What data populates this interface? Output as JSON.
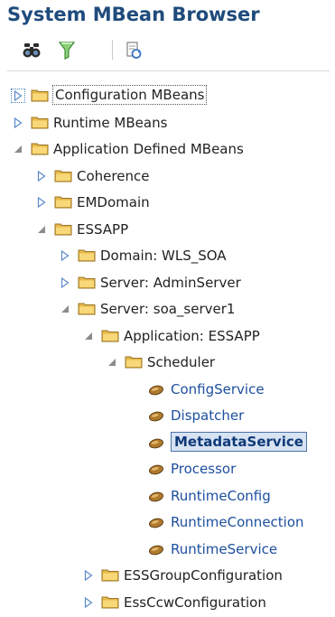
{
  "title": "System MBean Browser",
  "toolbar": {
    "find_icon": "binoculars-icon",
    "filter_icon": "filter-icon",
    "refresh_icon": "refresh-icon"
  },
  "tree": [
    {
      "label": "Configuration MBeans",
      "expanded": false,
      "type": "folder",
      "focused": true
    },
    {
      "label": "Runtime MBeans",
      "expanded": false,
      "type": "folder"
    },
    {
      "label": "Application Defined MBeans",
      "expanded": true,
      "type": "folder"
    },
    {
      "label": "Coherence",
      "expanded": false,
      "type": "folder"
    },
    {
      "label": "EMDomain",
      "expanded": false,
      "type": "folder"
    },
    {
      "label": "ESSAPP",
      "expanded": true,
      "type": "folder"
    },
    {
      "label": "Domain: WLS_SOA",
      "expanded": false,
      "type": "folder"
    },
    {
      "label": "Server: AdminServer",
      "expanded": false,
      "type": "folder"
    },
    {
      "label": "Server: soa_server1",
      "expanded": true,
      "type": "folder"
    },
    {
      "label": "Application: ESSAPP",
      "expanded": true,
      "type": "folder"
    },
    {
      "label": "Scheduler",
      "expanded": true,
      "type": "folder"
    },
    {
      "label": "ConfigService",
      "type": "mbean"
    },
    {
      "label": "Dispatcher",
      "type": "mbean"
    },
    {
      "label": "MetadataService",
      "type": "mbean",
      "selected": true
    },
    {
      "label": "Processor",
      "type": "mbean"
    },
    {
      "label": "RuntimeConfig",
      "type": "mbean"
    },
    {
      "label": "RuntimeConnection",
      "type": "mbean"
    },
    {
      "label": "RuntimeService",
      "type": "mbean"
    },
    {
      "label": "ESSGroupConfiguration",
      "expanded": false,
      "type": "folder"
    },
    {
      "label": "EssCcwConfiguration",
      "expanded": false,
      "type": "folder"
    }
  ],
  "colors": {
    "title": "#1f4b7c",
    "link": "#1d4f9e",
    "selection_bg": "#d7e3f3",
    "selection_border": "#4a72a8"
  }
}
